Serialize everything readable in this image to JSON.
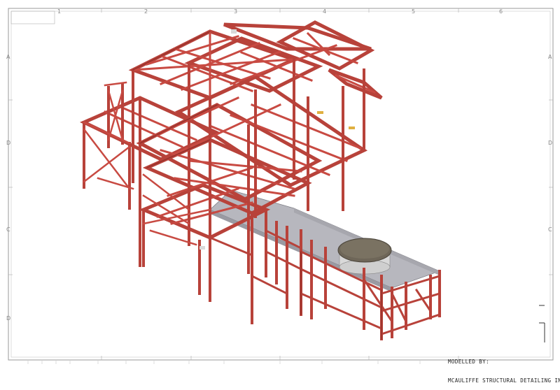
{
  "drawing": {
    "credit_line1": "MODELLED BY:",
    "credit_line2": "MCAULIFFE STRUCTURAL DETAILING INC.",
    "column_zones": [
      "1",
      "2",
      "3",
      "4",
      "5",
      "6"
    ],
    "row_zones": [
      "A",
      "D",
      "C",
      "D"
    ],
    "colors": {
      "steel": "#c84a42",
      "steel_dark": "#8f2e28",
      "deck": "#b5b5bc",
      "tank_top": "#6e6658",
      "tank_side": "#d8d8d8",
      "border": "#9a9a9a"
    }
  }
}
